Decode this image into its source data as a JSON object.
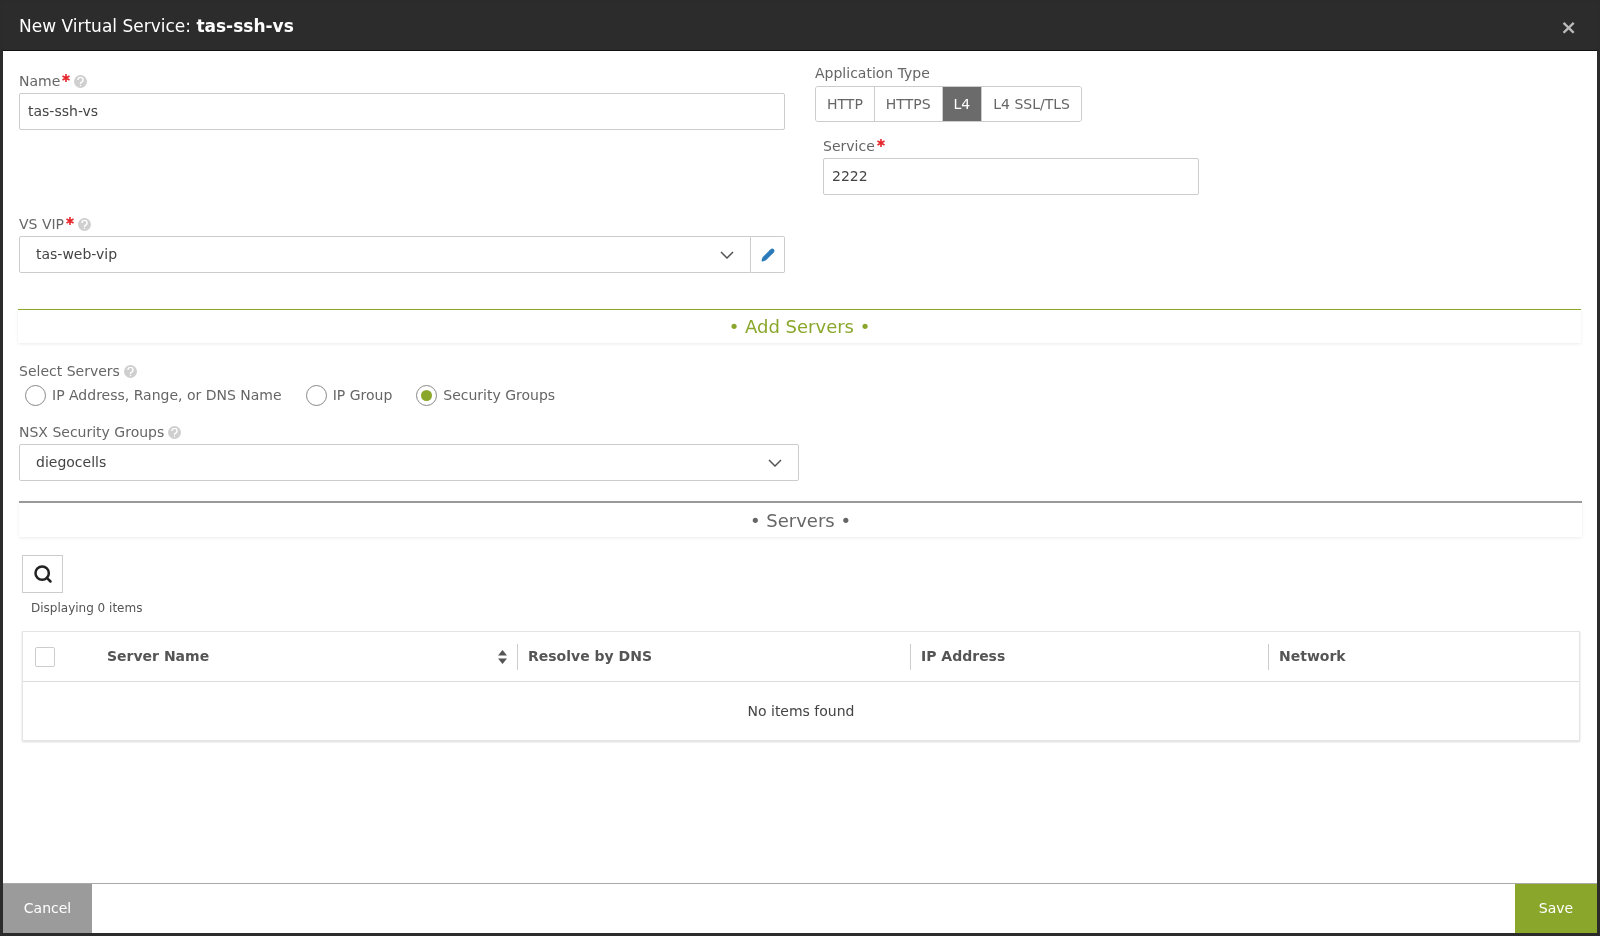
{
  "window": {
    "title_prefix": "New Virtual Service: ",
    "title_name": "tas-ssh-vs",
    "close": "×"
  },
  "name_field": {
    "label": "Name",
    "required": true,
    "help": true,
    "value": "tas-ssh-vs"
  },
  "application_type": {
    "label": "Application Type",
    "options": [
      {
        "label": "HTTP",
        "selected": false
      },
      {
        "label": "HTTPS",
        "selected": false
      },
      {
        "label": "L4",
        "selected": true
      },
      {
        "label": "L4 SSL/TLS",
        "selected": false
      }
    ]
  },
  "service_field": {
    "label": "Service",
    "required": true,
    "help": false,
    "value": "2222"
  },
  "vs_vip": {
    "label": "VS VIP",
    "required": true,
    "help": true,
    "value": "tas-web-vip"
  },
  "add_servers": {
    "heading": "• Add Servers •",
    "select_label": "Select Servers",
    "help": true,
    "options": [
      {
        "label": "IP Address, Range, or DNS Name",
        "selected": false
      },
      {
        "label": "IP Group",
        "selected": false
      },
      {
        "label": "Security Groups",
        "selected": true
      }
    ],
    "nsx": {
      "label": "NSX Security Groups",
      "help": true,
      "value": "diegocells"
    }
  },
  "servers": {
    "heading": "• Servers •",
    "count": "Displaying 0 items",
    "select_all_checked": false,
    "columns": [
      {
        "label": "Server Name",
        "sortable": true
      },
      {
        "label": "Resolve by DNS",
        "sortable": false
      },
      {
        "label": "IP Address",
        "sortable": false
      },
      {
        "label": "Network",
        "sortable": false
      }
    ],
    "empty": "No items found"
  },
  "footer": {
    "cancel": "Cancel",
    "save": "Save"
  }
}
